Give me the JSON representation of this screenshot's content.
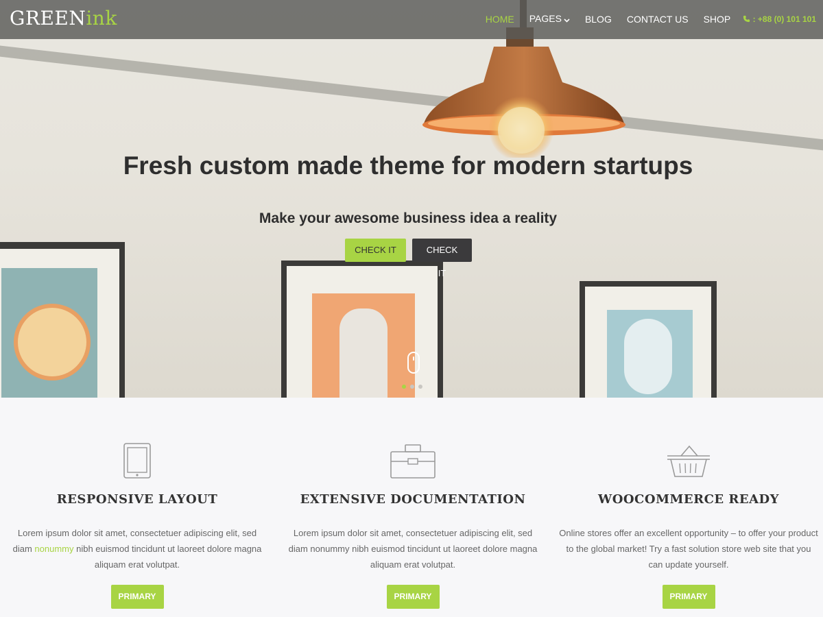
{
  "brand": {
    "part1": "GREEN",
    "part2": "ink"
  },
  "nav": {
    "home": "HOME",
    "pages": "PAGES",
    "blog": "BLOG",
    "contact": "CONTACT US",
    "shop": "SHOP",
    "phone": ": +88 (0) 101 101"
  },
  "hero": {
    "title": "Fresh custom made theme for modern startups",
    "subtitle": "Make your awesome business idea a reality",
    "btn_primary": "CHECK IT",
    "btn_secondary": "CHECK IT",
    "slides_total": 3,
    "slide_active": 1
  },
  "features": [
    {
      "icon": "tablet-icon",
      "title": "RESPONSIVE LAYOUT",
      "text_before": "Lorem ipsum dolor sit amet, consectetuer adipiscing elit, sed diam ",
      "text_highlight": "nonummy",
      "text_after": " nibh euismod tincidunt ut laoreet dolore magna aliquam erat volutpat.",
      "button": "PRIMARY"
    },
    {
      "icon": "toolbox-icon",
      "title": "EXTENSIVE DOCUMENTATION",
      "text_before": "Lorem ipsum dolor sit amet, consectetuer adipiscing elit, sed diam nonummy nibh euismod tincidunt ut laoreet dolore magna aliquam erat volutpat.",
      "text_highlight": "",
      "text_after": "",
      "button": "PRIMARY"
    },
    {
      "icon": "basket-icon",
      "title": "WOOCOMMERCE READY",
      "text_before": "Online stores offer an excellent opportunity – to offer your product to the global market! Try a fast solution store web site that you can update yourself.",
      "text_highlight": "",
      "text_after": "",
      "button": "PRIMARY"
    }
  ],
  "colors": {
    "accent": "#a8d444",
    "dark_button": "#3b3a3c",
    "nav_bg": "#5a5a58"
  }
}
